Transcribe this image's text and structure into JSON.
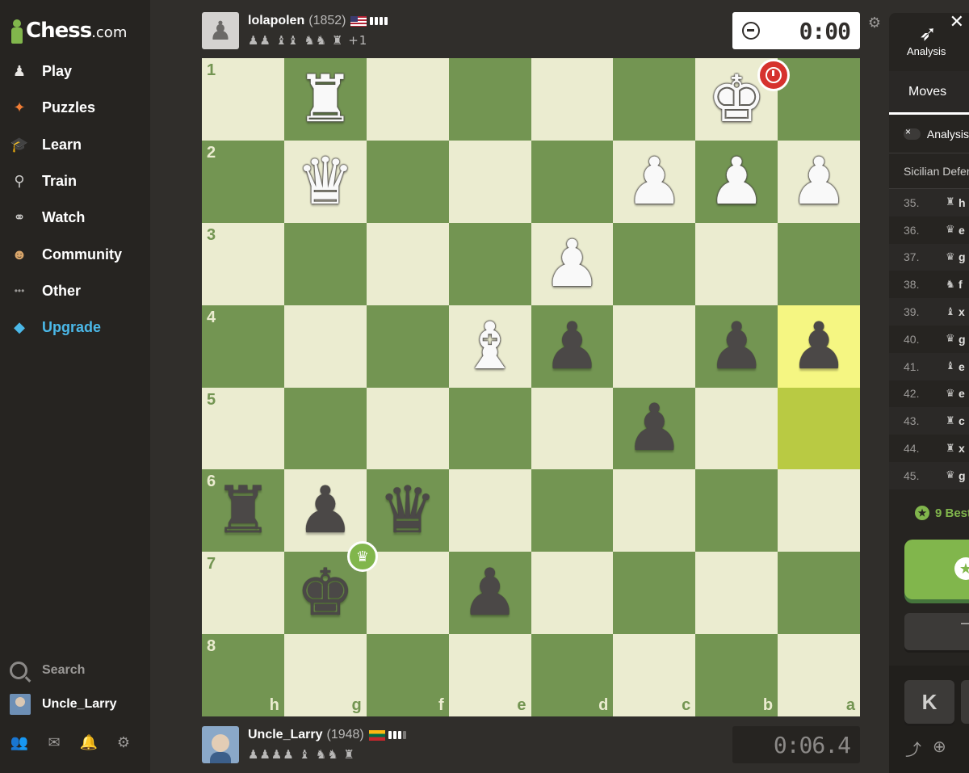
{
  "brand": {
    "name": "Chess",
    "suffix": ".com"
  },
  "sidebar": {
    "items": [
      {
        "label": "Play",
        "icon": "play-icon",
        "glyph": "♟",
        "color": "#e8e6e3"
      },
      {
        "label": "Puzzles",
        "icon": "puzzles-icon",
        "glyph": "✦",
        "color": "#f07d35"
      },
      {
        "label": "Learn",
        "icon": "learn-icon",
        "glyph": "🎓",
        "color": "#4bb8e8"
      },
      {
        "label": "Train",
        "icon": "train-icon",
        "glyph": "⚲",
        "color": "#c9c8c6"
      },
      {
        "label": "Watch",
        "icon": "watch-icon",
        "glyph": "⚭",
        "color": "#c9c8c6"
      },
      {
        "label": "Community",
        "icon": "community-icon",
        "glyph": "☻",
        "color": "#d9a66b"
      },
      {
        "label": "Other",
        "icon": "more-icon",
        "glyph": "•••",
        "color": "#9b9997"
      },
      {
        "label": "Upgrade",
        "icon": "diamond-icon",
        "glyph": "◆",
        "color": "#4bb8e8"
      }
    ],
    "search_label": "Search",
    "username": "Uncle_Larry"
  },
  "top_player": {
    "name": "lolapolen",
    "rating": "(1852)",
    "captured": "♟♟ ♝♝ ♞♞ ♜",
    "captured_extra": "+1",
    "clock": "0:00"
  },
  "bottom_player": {
    "name": "Uncle_Larry",
    "rating": "(1948)",
    "captured": "♟♟♟♟ ♝ ♞♞ ♜",
    "clock": "0:06.4"
  },
  "board": {
    "ranks": [
      "1",
      "2",
      "3",
      "4",
      "5",
      "6",
      "7",
      "8"
    ],
    "files": [
      "h",
      "g",
      "f",
      "e",
      "d",
      "c",
      "b",
      "a"
    ],
    "rows": [
      [
        "",
        "wR",
        "",
        "",
        "",
        "",
        "wK",
        ""
      ],
      [
        "",
        "wQ",
        "",
        "",
        "",
        "wP",
        "wP",
        "wP"
      ],
      [
        "",
        "",
        "",
        "",
        "wP",
        "",
        "",
        ""
      ],
      [
        "",
        "",
        "",
        "wB",
        "bP",
        "",
        "bP",
        "bP"
      ],
      [
        "",
        "",
        "",
        "",
        "",
        "bP",
        "",
        ""
      ],
      [
        "bR",
        "bP",
        "bQ",
        "",
        "",
        "",
        "",
        ""
      ],
      [
        "",
        "bK",
        "",
        "bP",
        "",
        "",
        "",
        ""
      ],
      [
        "",
        "",
        "",
        "",
        "",
        "",
        "",
        ""
      ]
    ],
    "highlights": [
      [
        3,
        7
      ],
      [
        4,
        7
      ]
    ]
  },
  "right_panel": {
    "analysis_label": "Analysis",
    "moves_tab": "Moves",
    "analysis_toggle_label": "Analysis",
    "opening": "Sicilian Defense",
    "moves": [
      {
        "num": "35.",
        "glyph": "♜",
        "move": "h"
      },
      {
        "num": "36.",
        "glyph": "♛",
        "move": "e"
      },
      {
        "num": "37.",
        "glyph": "♛",
        "move": "g"
      },
      {
        "num": "38.",
        "glyph": "♞",
        "move": "f"
      },
      {
        "num": "39.",
        "glyph": "♝",
        "move": "x"
      },
      {
        "num": "40.",
        "glyph": "♛",
        "move": "g"
      },
      {
        "num": "41.",
        "glyph": "♝",
        "move": "e"
      },
      {
        "num": "42.",
        "glyph": "♛",
        "move": "e"
      },
      {
        "num": "43.",
        "glyph": "♜",
        "move": "c"
      },
      {
        "num": "44.",
        "glyph": "♜",
        "move": "x"
      },
      {
        "num": "45.",
        "glyph": "♛",
        "move": "g"
      }
    ],
    "best_label": "9 Best"
  }
}
